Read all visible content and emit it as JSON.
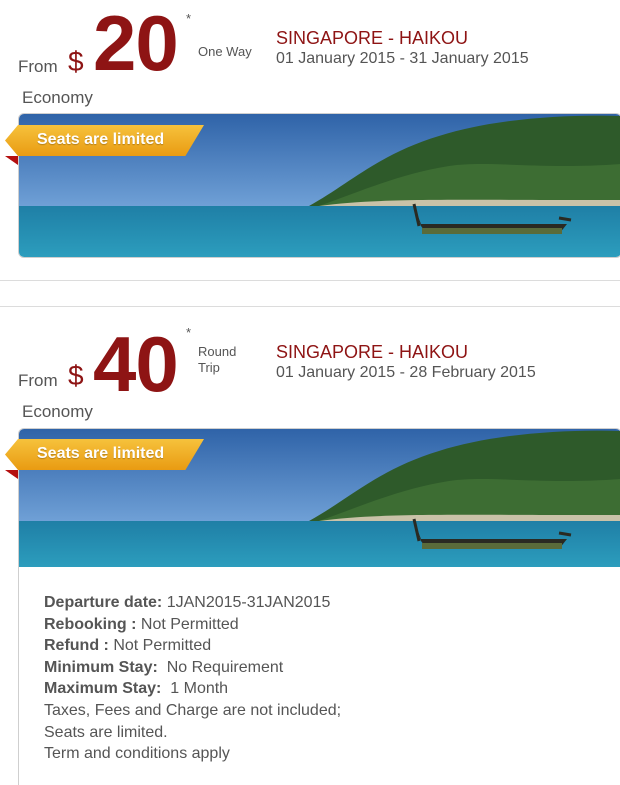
{
  "offers": [
    {
      "from_label": "From",
      "currency": "$",
      "price": "20",
      "asterisk": "*",
      "trip_line1": "One Way",
      "trip_line2": "",
      "route": "SINGAPORE - HAIKOU",
      "dates": "01 January 2015 - 31 January 2015",
      "cabin": "Economy",
      "ribbon": "Seats are limited"
    },
    {
      "from_label": "From",
      "currency": "$",
      "price": "40",
      "asterisk": "*",
      "trip_line1": "Round",
      "trip_line2": "Trip",
      "route": "SINGAPORE - HAIKOU",
      "dates": "01 January 2015 - 28 February 2015",
      "cabin": "Economy",
      "ribbon": "Seats are limited"
    }
  ],
  "details": {
    "departure_label": "Departure date:",
    "departure_value": " 1JAN2015-31JAN2015",
    "rebooking_label": "Rebooking :",
    "rebooking_value": " Not Permitted",
    "refund_label": "Refund :",
    "refund_value": " Not Permitted",
    "min_stay_label": "Minimum Stay:",
    "min_stay_value": "  No Requirement",
    "max_stay_label": "Maximum Stay:",
    "max_stay_value": "  1 Month",
    "taxes_note": "Taxes, Fees and Charge are not included;",
    "seats_note": "Seats are limited.",
    "terms_note": "Term and conditions apply"
  },
  "colors": {
    "price_red": "#8e1414",
    "ribbon_gold": "#f3b42a",
    "ribbon_fold_red": "#b40f0f",
    "sea": "#1f7fa6",
    "sky": "#4a7fc0"
  }
}
